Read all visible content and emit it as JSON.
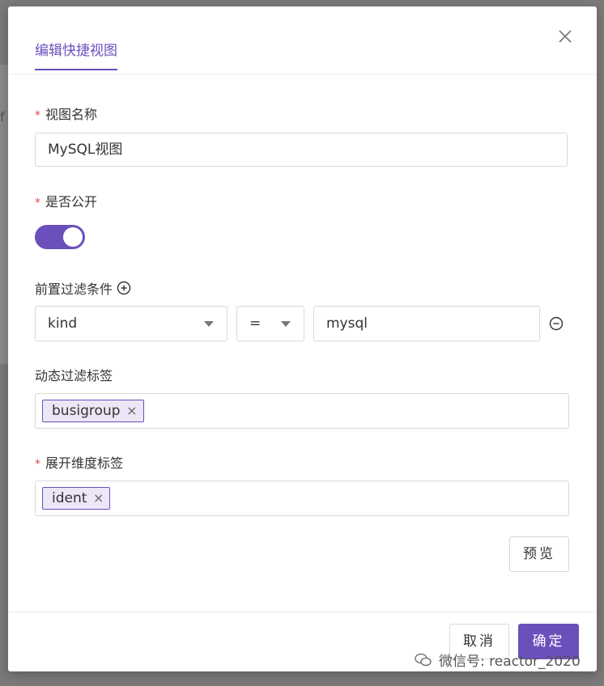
{
  "modal": {
    "title": "编辑快捷视图",
    "close_icon": "close-icon"
  },
  "form": {
    "view_name": {
      "label": "视图名称",
      "required": true,
      "value": "MySQL视图"
    },
    "is_public": {
      "label": "是否公开",
      "required": true,
      "checked": true
    },
    "pre_filter": {
      "label": "前置过滤条件",
      "key": "kind",
      "operator": "=",
      "value": "mysql"
    },
    "dynamic_tags": {
      "label": "动态过滤标签",
      "tags": [
        "busigroup"
      ]
    },
    "expand_dimension_tags": {
      "label": "展开维度标签",
      "required": true,
      "tags": [
        "ident"
      ]
    },
    "preview_button": "预览"
  },
  "footer": {
    "cancel_label": "取消",
    "confirm_label": "确定"
  },
  "watermark": "微信号: reactor_2020",
  "colors": {
    "accent": "#6b4fbb",
    "required": "#e04a4a"
  }
}
